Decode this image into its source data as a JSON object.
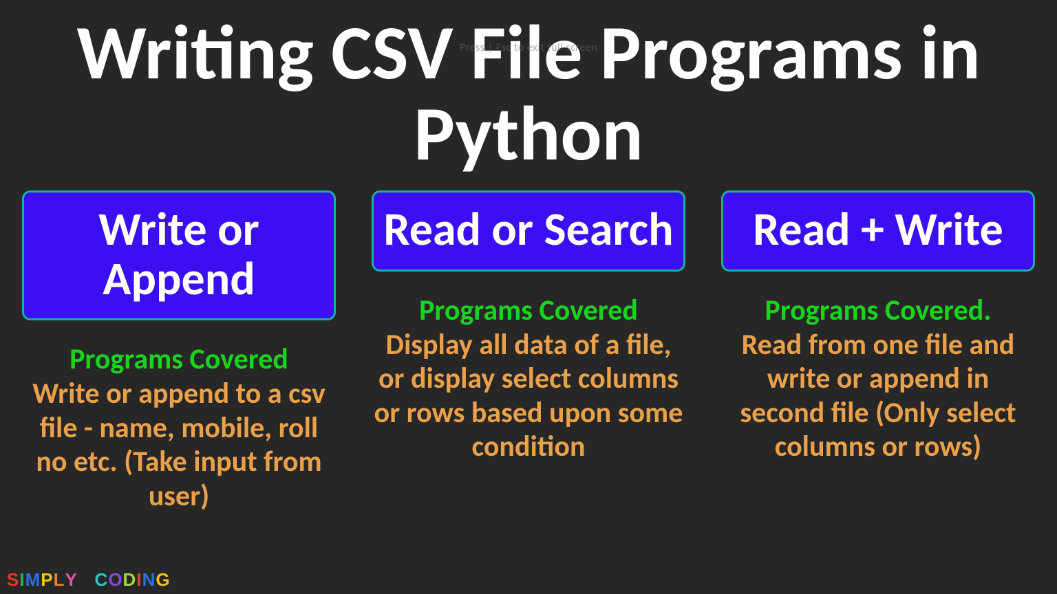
{
  "title": "Writing CSV File Programs in Python",
  "overlay_hint": "Press | Esc to exit full screen",
  "columns": [
    {
      "card_label": "Write or Append",
      "subhead": "Programs Covered",
      "desc": "Write or append to a csv file  - name, mobile, roll no etc. (Take input from user)"
    },
    {
      "card_label": "Read or Search",
      "subhead": "Programs Covered",
      "desc": "Display all data of a file, or display select columns or rows based upon some condition"
    },
    {
      "card_label": "Read + Write",
      "subhead": "Programs Covered.",
      "desc": "Read from one file and write or append in second file (Only select columns or rows)"
    }
  ],
  "logo": {
    "word1": [
      "S",
      "I",
      "M",
      "P",
      "L",
      "Y"
    ],
    "word2": [
      "C",
      "O",
      "D",
      "I",
      "N",
      "G"
    ]
  }
}
